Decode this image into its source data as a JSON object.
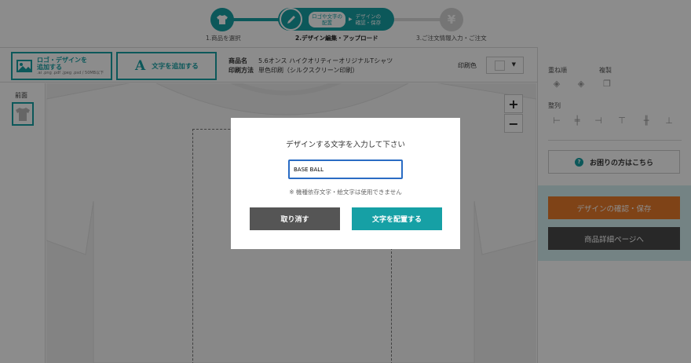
{
  "steps": [
    {
      "label": "1.商品を選択",
      "icon": "tshirt-icon"
    },
    {
      "label": "2.デザイン編集・アップロード",
      "sub1": "ロゴや文字の\n配置",
      "sub2": "デザインの\n確認・保存",
      "icon": "pencil-icon"
    },
    {
      "label": "3.ご注文情報入力・ご注文",
      "icon": "yen-icon"
    }
  ],
  "toolbar": {
    "add_logo_line1": "ロゴ・デザインを",
    "add_logo_line2": "追加する",
    "add_logo_formats": ".ai .png .pdf .jpeg .psd / 50MB以下",
    "add_text_label": "文字を追加する",
    "product_label": "商品名",
    "product_value": "5.6オンス ハイクオリティーオリジナルTシャツ",
    "print_method_label": "印刷方法",
    "print_method_value": "単色印刷（シルクスクリーン印刷）",
    "print_color_label": "印刷色"
  },
  "left_panel": {
    "front_label": "前面"
  },
  "canvas": {
    "zoom_in": "+",
    "zoom_out": "−"
  },
  "right_panel": {
    "layer_label": "重ね順",
    "duplicate_label": "複製",
    "align_label": "整列",
    "help_label": "お困りの方はこちら",
    "confirm_label": "デザインの確認・保存",
    "detail_label": "商品詳細ページへ"
  },
  "modal": {
    "title": "デザインする文字を入力して下さい",
    "input_value": "BASE BALL",
    "note": "※ 機種依存文字・絵文字は使用できません",
    "cancel_label": "取り消す",
    "place_label": "文字を配置する"
  },
  "colors": {
    "accent": "#16a0a5",
    "orange": "#e87a2a",
    "dark": "#4a4a4a",
    "focus": "#2a6cc4"
  }
}
